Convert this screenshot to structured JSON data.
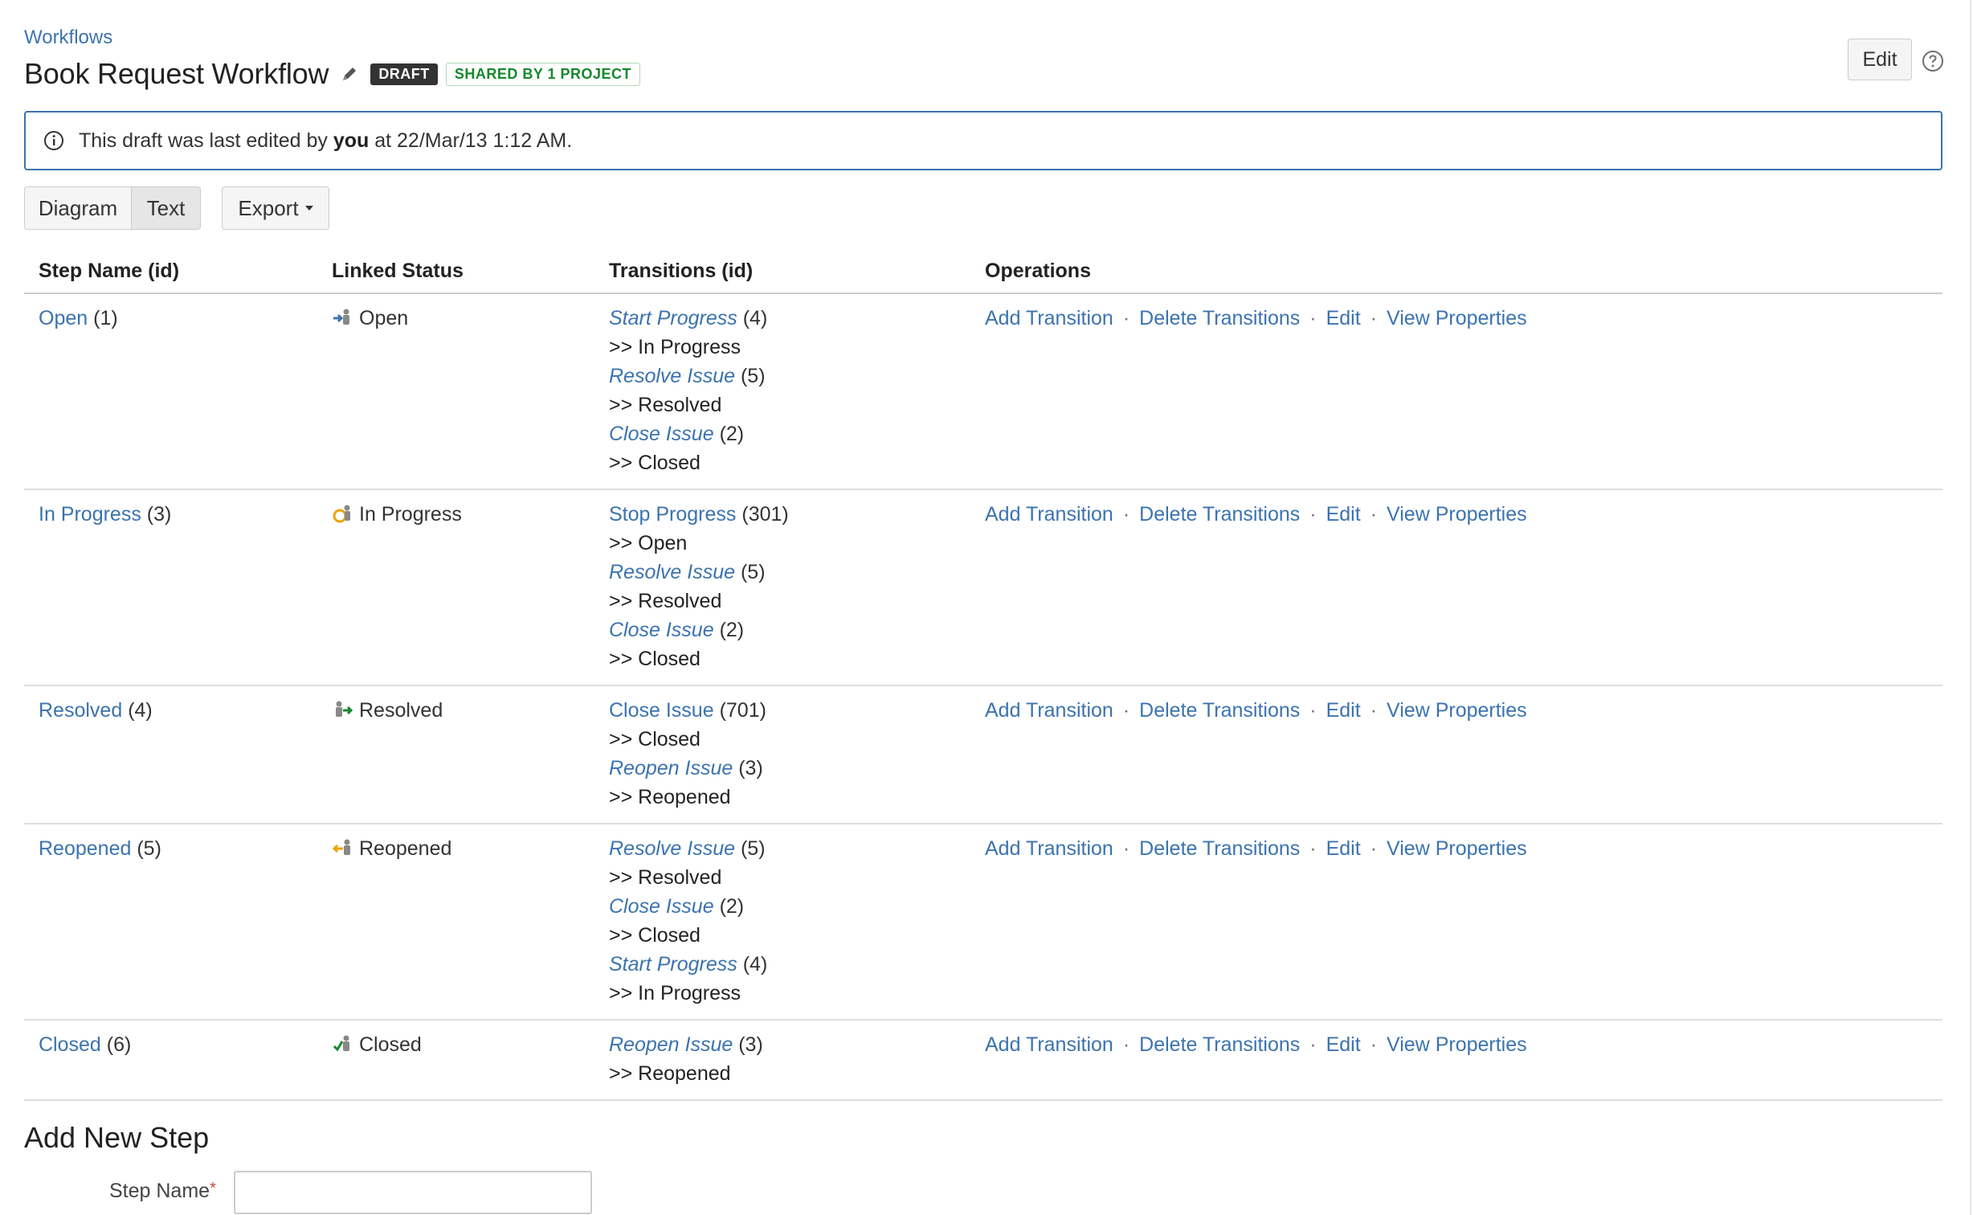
{
  "breadcrumb": "Workflows",
  "title": "Book Request Workflow",
  "badges": {
    "draft": "DRAFT",
    "shared": "SHARED BY 1 PROJECT"
  },
  "header_actions": {
    "edit_label": "Edit"
  },
  "info": {
    "prefix": "This draft was last edited by",
    "user": "you",
    "suffix": "at 22/Mar/13 1:12 AM."
  },
  "view_toggle": {
    "diagram": "Diagram",
    "text": "Text"
  },
  "export_label": "Export",
  "table": {
    "headers": [
      "Step Name (id)",
      "Linked Status",
      "Transitions (id)",
      "Operations"
    ],
    "rows": [
      {
        "step": "Open",
        "id": "(1)",
        "status": "Open",
        "status_icon": "open-status-icon",
        "transitions": [
          {
            "name": "Start Progress",
            "id": "(4)",
            "target": ">> In Progress",
            "italic": true
          },
          {
            "name": "Resolve Issue",
            "id": "(5)",
            "target": ">> Resolved",
            "italic": true
          },
          {
            "name": "Close Issue",
            "id": "(2)",
            "target": ">> Closed",
            "italic": true
          }
        ]
      },
      {
        "step": "In Progress",
        "id": "(3)",
        "status": "In Progress",
        "status_icon": "in-progress-status-icon",
        "transitions": [
          {
            "name": "Stop Progress",
            "id": "(301)",
            "target": ">> Open",
            "italic": false
          },
          {
            "name": "Resolve Issue",
            "id": "(5)",
            "target": ">> Resolved",
            "italic": true
          },
          {
            "name": "Close Issue",
            "id": "(2)",
            "target": ">> Closed",
            "italic": true
          }
        ]
      },
      {
        "step": "Resolved",
        "id": "(4)",
        "status": "Resolved",
        "status_icon": "resolved-status-icon",
        "transitions": [
          {
            "name": "Close Issue",
            "id": "(701)",
            "target": ">> Closed",
            "italic": false
          },
          {
            "name": "Reopen Issue",
            "id": "(3)",
            "target": ">> Reopened",
            "italic": true
          }
        ]
      },
      {
        "step": "Reopened",
        "id": "(5)",
        "status": "Reopened",
        "status_icon": "reopened-status-icon",
        "transitions": [
          {
            "name": "Resolve Issue",
            "id": "(5)",
            "target": ">> Resolved",
            "italic": true
          },
          {
            "name": "Close Issue",
            "id": "(2)",
            "target": ">> Closed",
            "italic": true
          },
          {
            "name": "Start Progress",
            "id": "(4)",
            "target": ">> In Progress",
            "italic": true
          }
        ]
      },
      {
        "step": "Closed",
        "id": "(6)",
        "status": "Closed",
        "status_icon": "closed-status-icon",
        "transitions": [
          {
            "name": "Reopen Issue",
            "id": "(3)",
            "target": ">> Reopened",
            "italic": true
          }
        ]
      }
    ],
    "operations": [
      "Add Transition",
      "Delete Transitions",
      "Edit",
      "View Properties"
    ],
    "operation_separator": "·"
  },
  "add_step": {
    "title": "Add New Step",
    "label": "Step Name",
    "required_mark": "*",
    "value": ""
  },
  "colors": {
    "link": "#3b73af",
    "draft_badge": "#333333",
    "shared_badge": "#14892c",
    "info_border": "#3b73af"
  }
}
